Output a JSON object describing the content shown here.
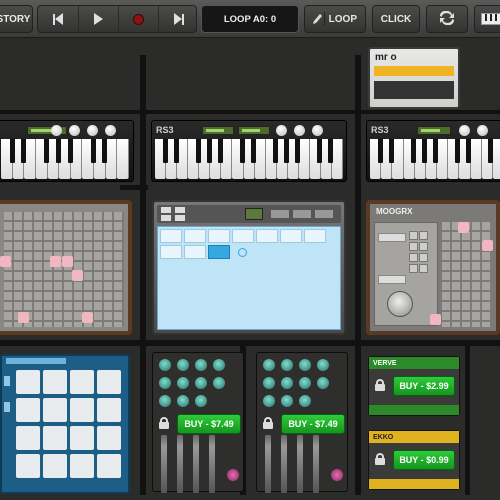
{
  "toolbar": {
    "story_label": "STORY",
    "loop_display": "LOOP A0: 0",
    "loop_button": "LOOP",
    "click_button": "CLICK"
  },
  "modules": {
    "rs3_center_label": "RS3",
    "rs3_right_label": "RS3",
    "mro_logo": "mr o",
    "moog_label": "MOOGRX",
    "verve_label": "VERVE",
    "ekko_label": "EKKO",
    "mixer_left_buy": "BUY - $7.49",
    "mixer_right_buy": "BUY - $7.49",
    "verve_buy": "BUY - $2.99",
    "ekko_buy": "BUY - $0.99"
  },
  "colors": {
    "buy_green": "#1fb22b",
    "drum_blue": "#1d5e87",
    "verve_green": "#2c8a2a",
    "ekko_yellow": "#e0b21f",
    "pad_pink": "#f2b6c0"
  }
}
